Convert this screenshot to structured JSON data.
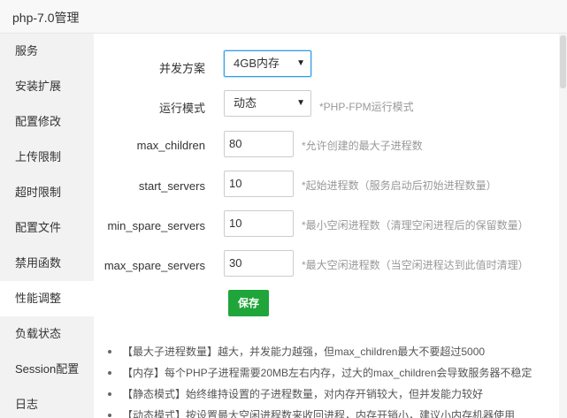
{
  "window": {
    "title": "php-7.0管理"
  },
  "sidebar": {
    "items": [
      {
        "label": "服务"
      },
      {
        "label": "安装扩展"
      },
      {
        "label": "配置修改"
      },
      {
        "label": "上传限制"
      },
      {
        "label": "超时限制"
      },
      {
        "label": "配置文件"
      },
      {
        "label": "禁用函数"
      },
      {
        "label": "性能调整",
        "active": true
      },
      {
        "label": "负载状态"
      },
      {
        "label": "Session配置"
      },
      {
        "label": "日志"
      }
    ]
  },
  "form": {
    "concurrency": {
      "label": "并发方案",
      "value": "4GB内存"
    },
    "run_mode": {
      "label": "运行模式",
      "value": "动态",
      "hint": "*PHP-FPM运行模式"
    },
    "max_children": {
      "label": "max_children",
      "value": "80",
      "hint": "*允许创建的最大子进程数"
    },
    "start_servers": {
      "label": "start_servers",
      "value": "10",
      "hint": "*起始进程数（服务启动后初始进程数量）"
    },
    "min_spare_servers": {
      "label": "min_spare_servers",
      "value": "10",
      "hint": "*最小空闲进程数（清理空闲进程后的保留数量）"
    },
    "max_spare_servers": {
      "label": "max_spare_servers",
      "value": "30",
      "hint": "*最大空闲进程数（当空闲进程达到此值时清理）"
    },
    "save_label": "保存"
  },
  "notes": [
    "【最大子进程数量】越大，并发能力越强，但max_children最大不要超过5000",
    "【内存】每个PHP子进程需要20MB左右内存，过大的max_children会导致服务器不稳定",
    "【静态模式】始终维持设置的子进程数量，对内存开销较大，但并发能力较好",
    "【动态模式】按设置最大空闲进程数来收回进程，内存开销小，建议小内存机器使用"
  ]
}
